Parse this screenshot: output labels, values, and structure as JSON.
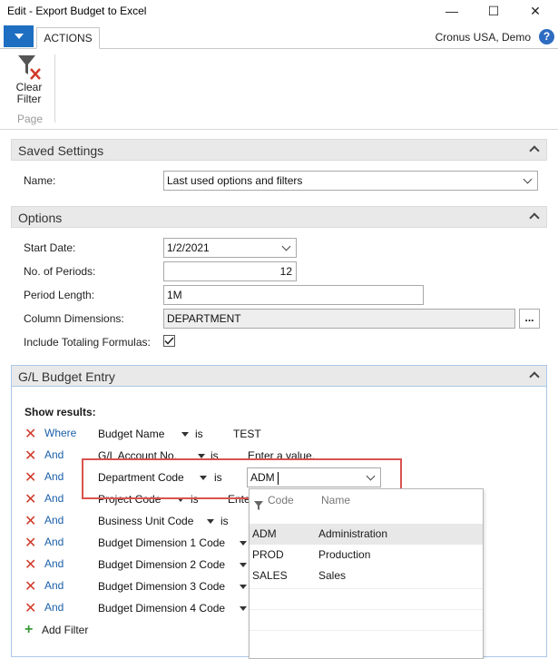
{
  "window": {
    "title": "Edit - Export Budget to Excel",
    "minimize": "—",
    "maximize": "☐",
    "close": "✕"
  },
  "ribbon": {
    "tab_actions": "ACTIONS",
    "company": "Cronus USA, Demo",
    "help": "?",
    "clear_filter_line1": "Clear",
    "clear_filter_line2": "Filter",
    "group_label": "Page"
  },
  "saved_settings": {
    "caption": "Saved Settings",
    "name_label": "Name:",
    "name_value": "Last used options and filters"
  },
  "options": {
    "caption": "Options",
    "start_date_label": "Start Date:",
    "start_date_value": "1/2/2021",
    "periods_label": "No. of Periods:",
    "periods_value": "12",
    "period_length_label": "Period Length:",
    "period_length_value": "1M",
    "column_dims_label": "Column Dimensions:",
    "column_dims_value": "DEPARTMENT",
    "assist_button": "...",
    "totaling_label": "Include Totaling Formulas:",
    "totaling_checked": true
  },
  "gl_entry": {
    "caption": "G/L Budget Entry",
    "show_results": "Show results:",
    "filters": [
      {
        "conj": "Where",
        "field": "Budget Name",
        "op": "is",
        "value": "TEST"
      },
      {
        "conj": "And",
        "field": "G/L Account No.",
        "op": "is",
        "value": "Enter a value."
      },
      {
        "conj": "And",
        "field": "Department Code",
        "op": "is",
        "value": "ADM"
      },
      {
        "conj": "And",
        "field": "Project Code",
        "op": "is",
        "value": "Ente"
      },
      {
        "conj": "And",
        "field": "Business Unit Code",
        "op": "is",
        "value": ""
      },
      {
        "conj": "And",
        "field": "Budget Dimension 1 Code",
        "op": "",
        "value": ""
      },
      {
        "conj": "And",
        "field": "Budget Dimension 2 Code",
        "op": "",
        "value": ""
      },
      {
        "conj": "And",
        "field": "Budget Dimension 3 Code",
        "op": "",
        "value": ""
      },
      {
        "conj": "And",
        "field": "Budget Dimension 4 Code",
        "op": "",
        "value": ""
      }
    ],
    "add_filter": "Add Filter"
  },
  "lookup": {
    "col_code": "Code",
    "col_name": "Name",
    "rows": [
      {
        "code": "ADM",
        "name": "Administration"
      },
      {
        "code": "PROD",
        "name": "Production"
      },
      {
        "code": "SALES",
        "name": "Sales"
      }
    ]
  },
  "colors": {
    "accent": "#1e6fc2",
    "remove_x": "#d03a2a",
    "highlight_box": "#d9534f",
    "selected_row": "#e8e8e8"
  }
}
